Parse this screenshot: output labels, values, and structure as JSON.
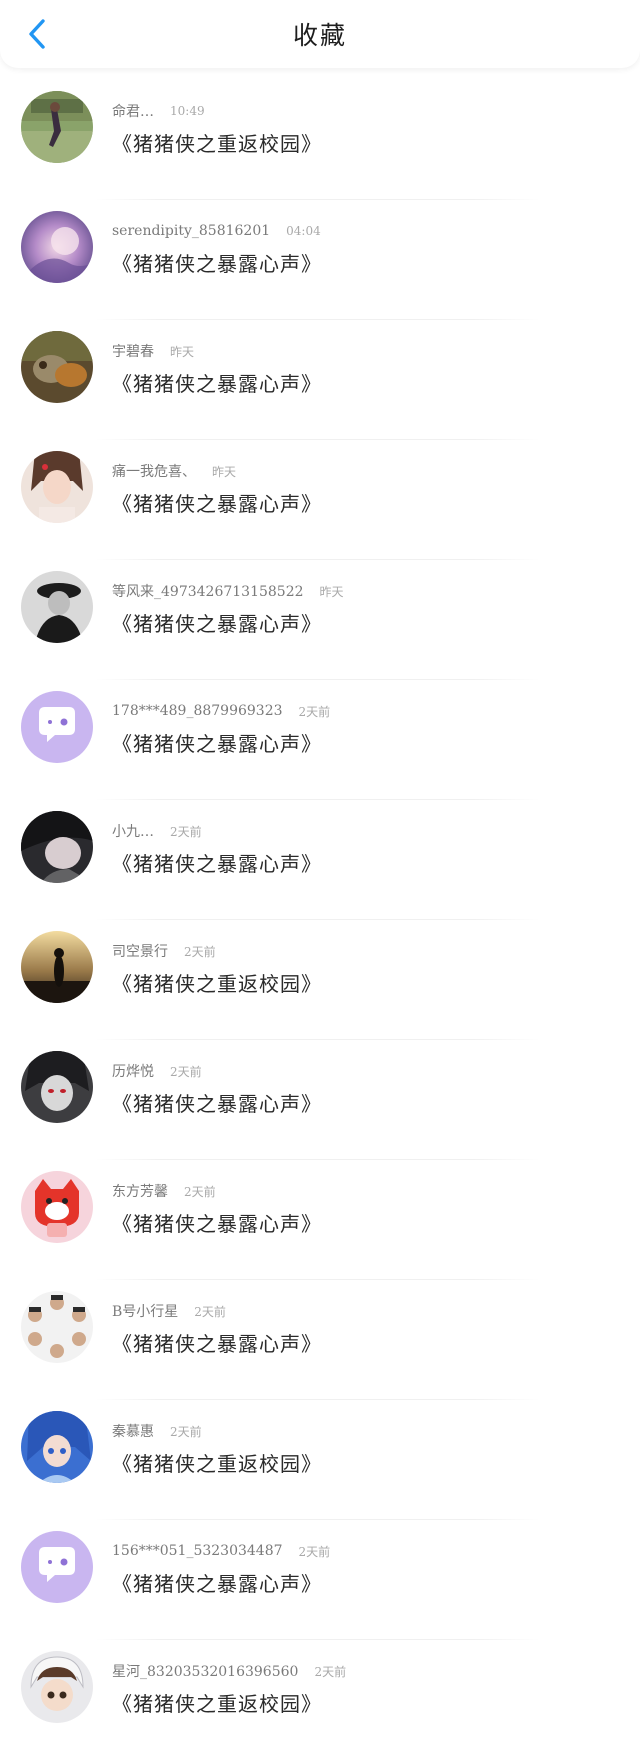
{
  "header": {
    "title": "收藏",
    "back_icon": "chevron-left-icon",
    "accent_color": "#2196f3"
  },
  "items": [
    {
      "user": "命君…",
      "time": "10:49",
      "title": "《猪猪侠之重返校园》",
      "avatar": "photo-landscape"
    },
    {
      "user": "serendipity_85816201",
      "time": "04:04",
      "title": "《猪猪侠之暴露心声》",
      "avatar": "photo-purple"
    },
    {
      "user": "宇碧春",
      "time": "昨天",
      "title": "《猪猪侠之暴露心声》",
      "avatar": "photo-bird"
    },
    {
      "user": "痛一我危喜、",
      "time": "昨天",
      "title": "《猪猪侠之暴露心声》",
      "avatar": "photo-woman"
    },
    {
      "user": "等风来_4973426713158522",
      "time": "昨天",
      "title": "《猪猪侠之暴露心声》",
      "avatar": "photo-bw"
    },
    {
      "user": "178***489_8879969323",
      "time": "2天前",
      "title": "《猪猪侠之暴露心声》",
      "avatar": "default-chat-icon"
    },
    {
      "user": "小九…",
      "time": "2天前",
      "title": "《猪猪侠之暴露心声》",
      "avatar": "photo-girl"
    },
    {
      "user": "司空景行",
      "time": "2天前",
      "title": "《猪猪侠之重返校园》",
      "avatar": "photo-sunset"
    },
    {
      "user": "历烨悦",
      "time": "2天前",
      "title": "《猪猪侠之暴露心声》",
      "avatar": "photo-anime-dark"
    },
    {
      "user": "东方芳馨",
      "time": "2天前",
      "title": "《猪猪侠之暴露心声》",
      "avatar": "photo-red-fox"
    },
    {
      "user": "B号小行星",
      "time": "2天前",
      "title": "《猪猪侠之暴露心声》",
      "avatar": "photo-group"
    },
    {
      "user": "秦慕惠",
      "time": "2天前",
      "title": "《猪猪侠之重返校园》",
      "avatar": "photo-anime-blue"
    },
    {
      "user": "156***051_5323034487",
      "time": "2天前",
      "title": "《猪猪侠之暴露心声》",
      "avatar": "default-chat-icon"
    },
    {
      "user": "星河_83203532016396560",
      "time": "2天前",
      "title": "《猪猪侠之重返校园》",
      "avatar": "photo-anime-boy"
    }
  ]
}
